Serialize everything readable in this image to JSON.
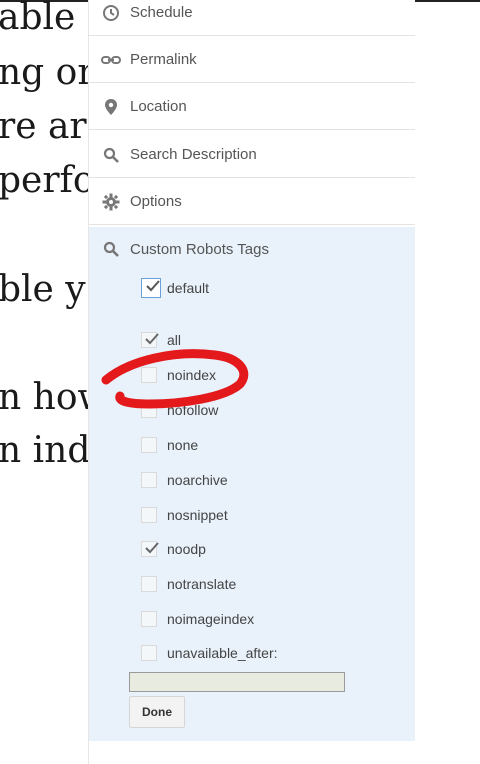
{
  "background_text": [
    "able a",
    "ng on",
    "re ar",
    "perfo",
    "ble y",
    "n how",
    "n ind"
  ],
  "sidebar": {
    "items": [
      {
        "label": "Schedule",
        "icon": "clock-icon"
      },
      {
        "label": "Permalink",
        "icon": "link-icon"
      },
      {
        "label": "Location",
        "icon": "location-pin-icon"
      },
      {
        "label": "Search Description",
        "icon": "search-icon"
      },
      {
        "label": "Options",
        "icon": "gear-icon"
      }
    ]
  },
  "robots": {
    "title": "Custom Robots Tags",
    "icon": "search-icon",
    "default_label": "default",
    "default_checked": true,
    "options": [
      {
        "label": "all",
        "checked": true
      },
      {
        "label": "noindex",
        "checked": false
      },
      {
        "label": "nofollow",
        "checked": false
      },
      {
        "label": "none",
        "checked": false
      },
      {
        "label": "noarchive",
        "checked": false
      },
      {
        "label": "nosnippet",
        "checked": false
      },
      {
        "label": "noodp",
        "checked": true
      },
      {
        "label": "notranslate",
        "checked": false
      },
      {
        "label": "noimageindex",
        "checked": false
      },
      {
        "label": "unavailable_after:",
        "checked": false
      }
    ],
    "unavailable_after_value": "",
    "done_label": "Done"
  },
  "colors": {
    "panel_background": "#e9f2fb",
    "annotation": "#e3191b"
  }
}
